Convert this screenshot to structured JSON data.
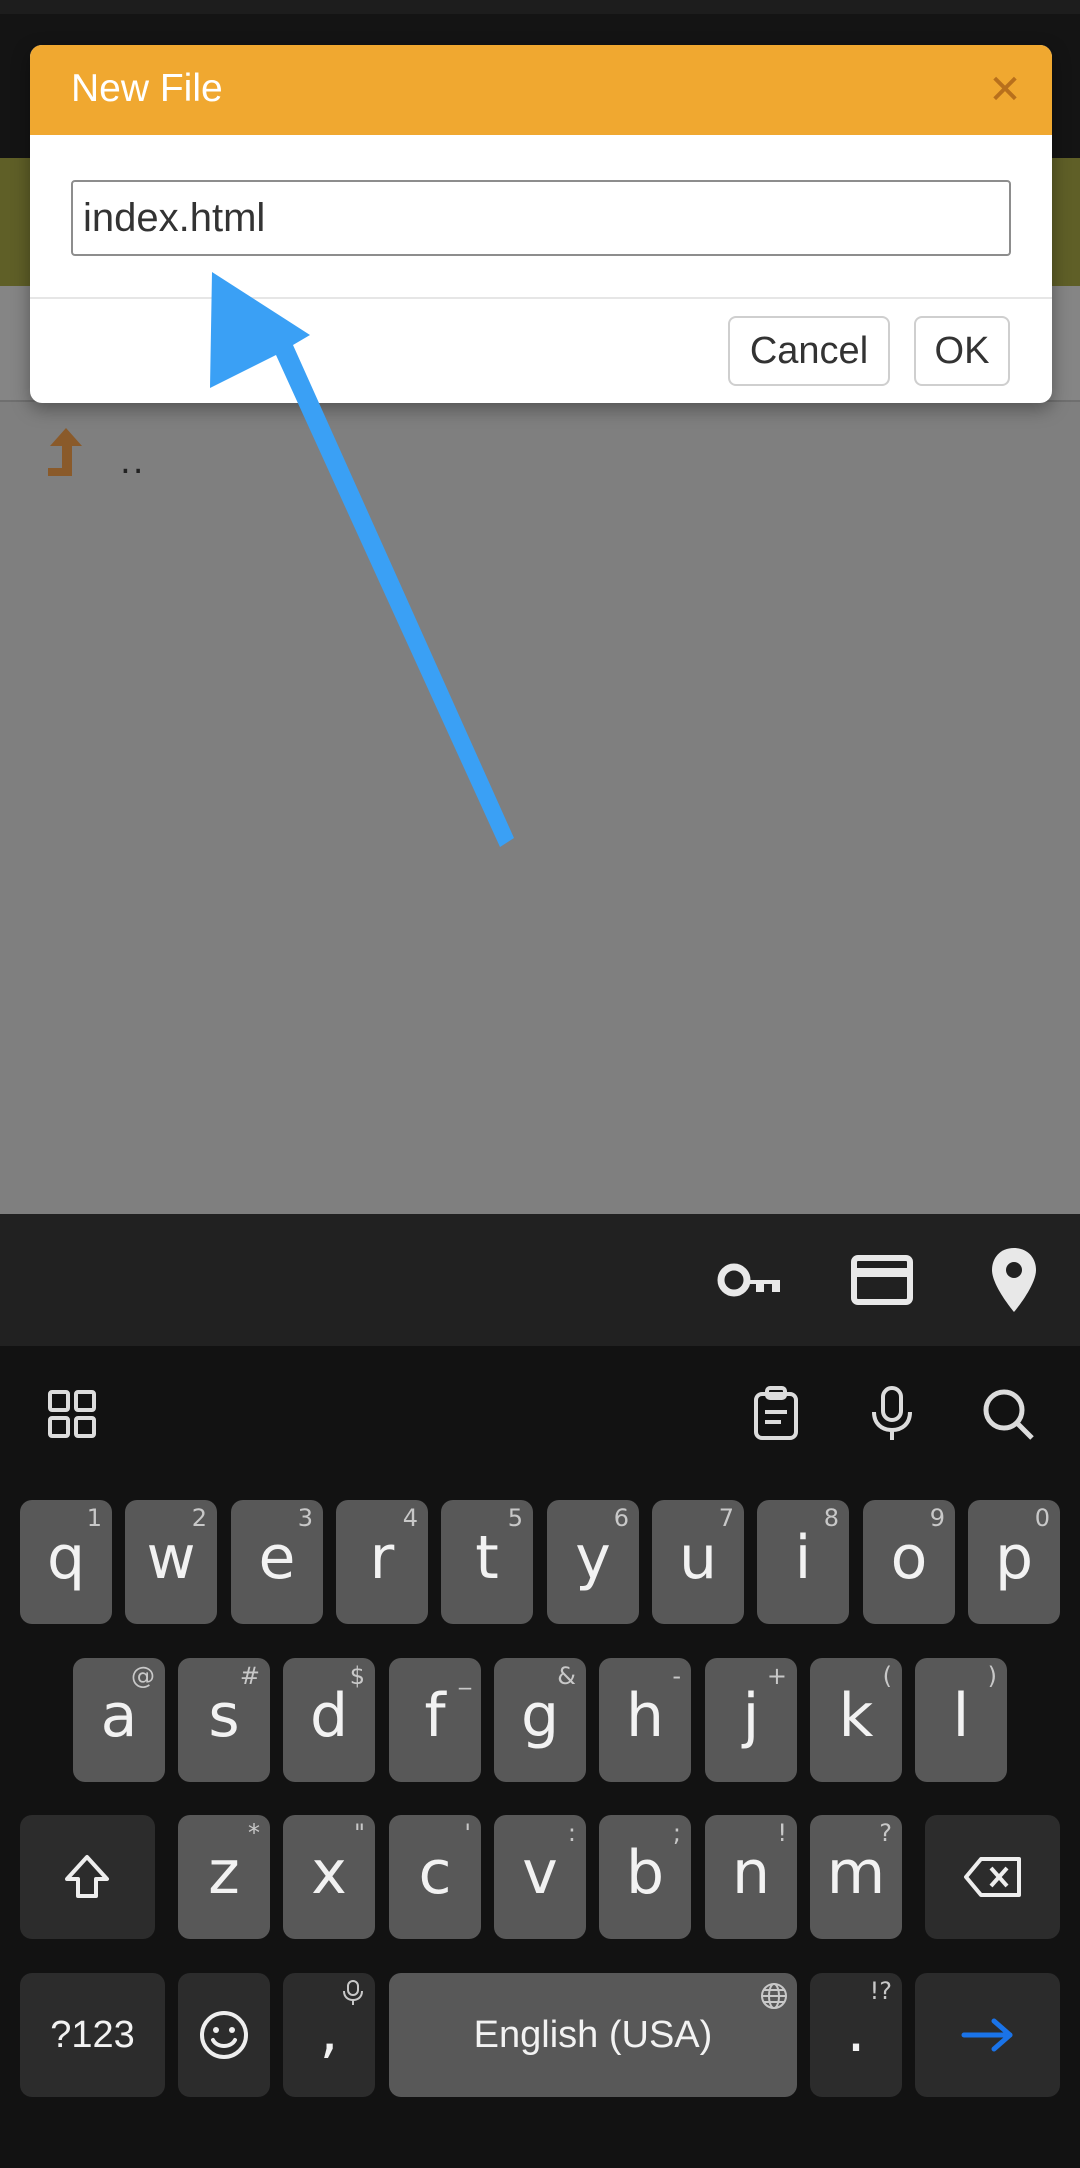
{
  "dialog": {
    "title": "New File",
    "close_icon": "close-icon",
    "filename_value": "index.html",
    "cancel_label": "Cancel",
    "ok_label": "OK"
  },
  "file_list": {
    "parent_dir_label": ".."
  },
  "autofill_bar": {
    "icons": [
      "key-icon",
      "credit-card-icon",
      "location-pin-icon"
    ]
  },
  "keyboard": {
    "toolbar_icons": [
      "grid-apps-icon",
      "clipboard-icon",
      "microphone-icon",
      "search-icon"
    ],
    "row1": [
      {
        "key": "q",
        "hint": "1"
      },
      {
        "key": "w",
        "hint": "2"
      },
      {
        "key": "e",
        "hint": "3"
      },
      {
        "key": "r",
        "hint": "4"
      },
      {
        "key": "t",
        "hint": "5"
      },
      {
        "key": "y",
        "hint": "6"
      },
      {
        "key": "u",
        "hint": "7"
      },
      {
        "key": "i",
        "hint": "8"
      },
      {
        "key": "o",
        "hint": "9"
      },
      {
        "key": "p",
        "hint": "0"
      }
    ],
    "row2": [
      {
        "key": "a",
        "hint": "@"
      },
      {
        "key": "s",
        "hint": "#"
      },
      {
        "key": "d",
        "hint": "$"
      },
      {
        "key": "f",
        "hint": "_"
      },
      {
        "key": "g",
        "hint": "&"
      },
      {
        "key": "h",
        "hint": "-"
      },
      {
        "key": "j",
        "hint": "+"
      },
      {
        "key": "k",
        "hint": "("
      },
      {
        "key": "l",
        "hint": ")"
      }
    ],
    "row3": [
      {
        "key": "z",
        "hint": "*"
      },
      {
        "key": "x",
        "hint": "\""
      },
      {
        "key": "c",
        "hint": "'"
      },
      {
        "key": "v",
        "hint": ":"
      },
      {
        "key": "b",
        "hint": ";"
      },
      {
        "key": "n",
        "hint": "!"
      },
      {
        "key": "m",
        "hint": "?"
      }
    ],
    "symbols_label": "?123",
    "comma_key": ",",
    "space_label": "English (USA)",
    "period_key": ".",
    "period_hint": "!?",
    "accent_color": "#1a73e8"
  },
  "colors": {
    "dialog_header": "#f0a830",
    "annotation_arrow": "#3aa0f5"
  }
}
